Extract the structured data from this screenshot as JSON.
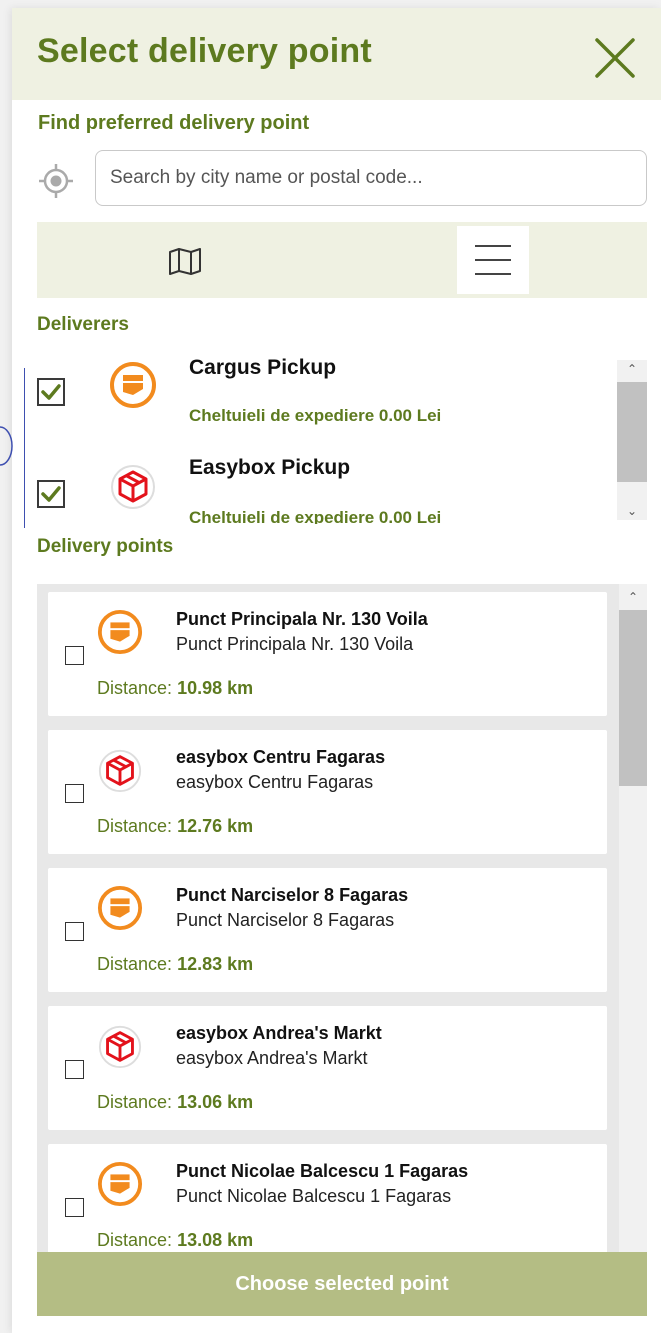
{
  "header": {
    "title": "Select delivery point"
  },
  "search": {
    "label": "Find preferred delivery point",
    "placeholder": "Search by city name or postal code..."
  },
  "deliverers": {
    "label": "Deliverers",
    "items": [
      {
        "name": "Cargus Pickup",
        "cost": "Cheltuieli de expediere 0.00 Lei",
        "checked": true,
        "icon": "cargus-logo-icon"
      },
      {
        "name": "Easybox Pickup",
        "cost": "Cheltuieli de expediere 0.00 Lei",
        "checked": true,
        "icon": "easybox-logo-icon"
      }
    ]
  },
  "points": {
    "label": "Delivery points",
    "distance_label": "Distance:",
    "items": [
      {
        "name": "Punct Principala Nr. 130 Voila",
        "subtitle": "Punct Principala Nr. 130 Voila",
        "distance": "10.98 km",
        "carrier": "cargus"
      },
      {
        "name": "easybox Centru Fagaras",
        "subtitle": "easybox Centru Fagaras",
        "distance": "12.76 km",
        "carrier": "easybox"
      },
      {
        "name": "Punct Narciselor 8 Fagaras",
        "subtitle": "Punct Narciselor 8 Fagaras",
        "distance": "12.83 km",
        "carrier": "cargus"
      },
      {
        "name": "easybox Andrea's Markt",
        "subtitle": "easybox Andrea's Markt",
        "distance": "13.06 km",
        "carrier": "easybox"
      },
      {
        "name": "Punct Nicolae Balcescu 1 Fagaras",
        "subtitle": "Punct Nicolae Balcescu 1 Fagaras",
        "distance": "13.08 km",
        "carrier": "cargus"
      }
    ]
  },
  "footer": {
    "choose_label": "Choose selected point"
  },
  "colors": {
    "accent": "#5d7a1f",
    "header_bg": "#eff1e2",
    "button_bg": "#b4bd84",
    "cargus": "#f28b1e",
    "easybox": "#e3121b"
  }
}
